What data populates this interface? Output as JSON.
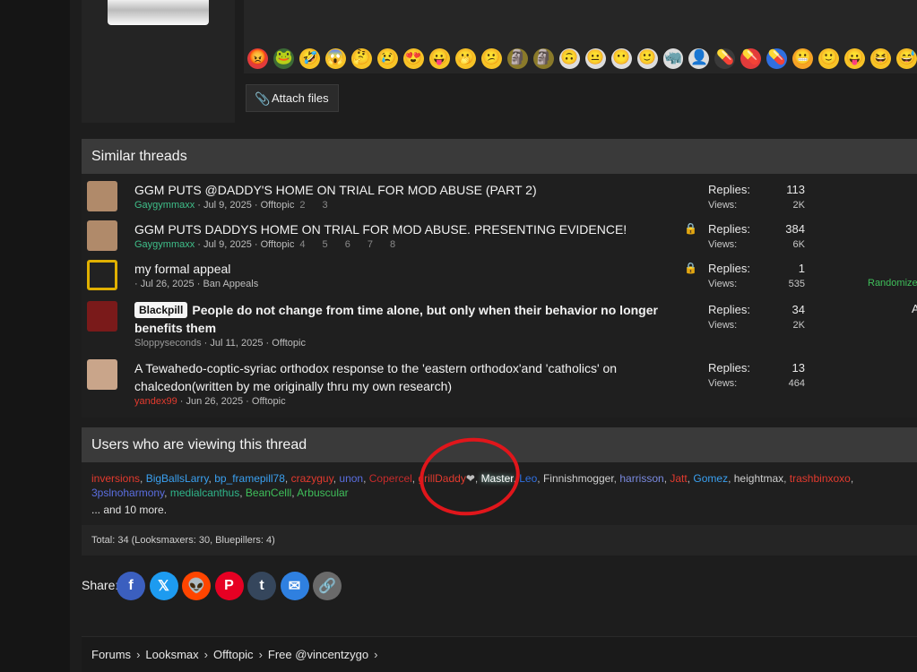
{
  "editor": {
    "attach_label": "Attach files",
    "emojis": [
      {
        "glyph": "😡",
        "bg": "#e23b3b"
      },
      {
        "glyph": "🐸",
        "bg": "#3c6b36"
      },
      {
        "glyph": "🤣",
        "bg": "#f7c326"
      },
      {
        "glyph": "😱",
        "bg": "#f7c326"
      },
      {
        "glyph": "🤔",
        "bg": "#f7c326"
      },
      {
        "glyph": "😢",
        "bg": "#f7c326"
      },
      {
        "glyph": "😍",
        "bg": "#f7c326"
      },
      {
        "glyph": "😛",
        "bg": "#f7c326"
      },
      {
        "glyph": "🫢",
        "bg": "#f7c326"
      },
      {
        "glyph": "😕",
        "bg": "#f7c326"
      },
      {
        "glyph": "🗿",
        "bg": "#8a7a2a"
      },
      {
        "glyph": "🗿",
        "bg": "#8a7a2a"
      },
      {
        "glyph": "🙃",
        "bg": "#dddddd"
      },
      {
        "glyph": "😐",
        "bg": "#dddddd"
      },
      {
        "glyph": "😶",
        "bg": "#dddddd"
      },
      {
        "glyph": "🙂",
        "bg": "#dddddd"
      },
      {
        "glyph": "🦏",
        "bg": "#dddddd"
      },
      {
        "glyph": "👤",
        "bg": "#dddddd"
      },
      {
        "glyph": "💊",
        "bg": "#3a3a3a"
      },
      {
        "glyph": "💊",
        "bg": "#e23b3b"
      },
      {
        "glyph": "💊",
        "bg": "#2f6fe0"
      },
      {
        "glyph": "😬",
        "bg": "#f7a326"
      },
      {
        "glyph": "🙂",
        "bg": "#f7c326"
      },
      {
        "glyph": "😛",
        "bg": "#f7c326"
      },
      {
        "glyph": "😆",
        "bg": "#f7c326"
      },
      {
        "glyph": "😅",
        "bg": "#f7c326"
      }
    ]
  },
  "similar": {
    "heading": "Similar threads",
    "labels": {
      "replies": "Replies:",
      "views": "Views:"
    },
    "threads": [
      {
        "title": "GGM PUTS @DADDY'S HOME ON TRIAL FOR MOD ABUSE (PART 2)",
        "author": "Gaygymmaxx",
        "date": "Jul 9, 2025",
        "forum": "Offtopic",
        "pages": "2 3",
        "locked": false,
        "replies": "113",
        "views": "2K",
        "avatar_color": "#b08a6a"
      },
      {
        "title": "GGM PUTS DADDYS HOME ON TRIAL FOR MOD ABUSE. PRESENTING EVIDENCE!",
        "author": "Gaygymmaxx",
        "date": "Jul 9, 2025",
        "forum": "Offtopic",
        "pages": "4 5 6 7 8",
        "locked": true,
        "replies": "384",
        "views": "6K",
        "avatar_color": "#b08a6a"
      },
      {
        "title": "my formal appeal",
        "author": "",
        "date": "Jul 26, 2025",
        "forum": "Ban Appeals",
        "pages": "",
        "locked": true,
        "replies": "1",
        "views": "535",
        "avatar_color": "#222222"
      },
      {
        "prefix": "Blackpill",
        "title": "People do not change from time alone, but only when their behavior no longer benefits them",
        "author": "Sloppyseconds",
        "date": "Jul 11, 2025",
        "forum": "Offtopic",
        "pages": "",
        "locked": false,
        "replies": "34",
        "views": "2K",
        "avatar_color": "#7a1a1a"
      },
      {
        "title": "A Tewahedo-coptic-syriac orthodox response to the 'eastern orthodox'and 'catholics' on chalcedon(written by me originally thru my own research)",
        "author": "yandex99",
        "date": "Jun 26, 2025",
        "forum": "Offtopic",
        "pages": "",
        "locked": false,
        "replies": "13",
        "views": "464",
        "avatar_color": "#c9a58a"
      }
    ],
    "right_fragments": [
      "Randomized",
      "A"
    ]
  },
  "viewers": {
    "heading": "Users who are viewing this thread",
    "users": [
      {
        "name": "inversions",
        "color": "#e33a2e"
      },
      {
        "name": "BigBallsLarry",
        "color": "#3aa0f0"
      },
      {
        "name": "bp_framepill78",
        "color": "#3aa0f0"
      },
      {
        "name": "crazyguy",
        "color": "#e33a2e"
      },
      {
        "name": "unon",
        "color": "#5a6ee0"
      },
      {
        "name": "Copercel",
        "color": "#c62b2b"
      },
      {
        "name": "grillDaddy",
        "color": "#e33a2e"
      },
      {
        "name": "Master",
        "color": "#ffffff"
      },
      {
        "name": "Leo",
        "color": "#2f6fe0"
      },
      {
        "name": "Finnishmogger",
        "color": "#cfcfcf"
      },
      {
        "name": "harrisson",
        "color": "#7a8ae0"
      },
      {
        "name": "Jatt",
        "color": "#e33a2e"
      },
      {
        "name": "Gomez",
        "color": "#3aa0f0"
      },
      {
        "name": "heightmax",
        "color": "#cfcfcf"
      },
      {
        "name": "trashbinxoxo",
        "color": "#e33a2e"
      },
      {
        "name": "3pslnoharmony",
        "color": "#5a6ee0"
      },
      {
        "name": "medialcanthus",
        "color": "#2fb58a"
      },
      {
        "name": "BeanCelll",
        "color": "#3fbf5a"
      },
      {
        "name": "Arbuscular",
        "color": "#3fbf5a"
      }
    ],
    "more": "... and 10 more.",
    "totals": "Total: 34 (Looksmaxers: 30, Bluepillers: 4)"
  },
  "share": {
    "label": "Share:",
    "buttons": [
      {
        "name": "facebook",
        "glyph": "f",
        "color": "#3b5fbf"
      },
      {
        "name": "x",
        "glyph": "𝕏",
        "color": "#1d9bf0"
      },
      {
        "name": "reddit",
        "glyph": "👽",
        "color": "#ff4500"
      },
      {
        "name": "pinterest",
        "glyph": "P",
        "color": "#e60023"
      },
      {
        "name": "tumblr",
        "glyph": "t",
        "color": "#35465c"
      },
      {
        "name": "email",
        "glyph": "✉",
        "color": "#2f80e0"
      },
      {
        "name": "link",
        "glyph": "🔗",
        "color": "#6a6a6a"
      }
    ]
  },
  "breadcrumb": [
    "Forums",
    "Looksmax",
    "Offtopic",
    "Free @vincentzygo"
  ]
}
